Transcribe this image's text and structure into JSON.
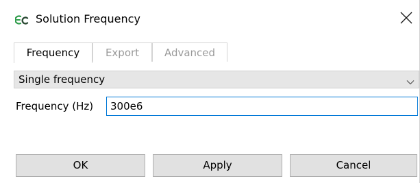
{
  "window": {
    "title": "Solution Frequency",
    "app_icon": "app-logo-icon",
    "close_icon": "close-icon"
  },
  "tabs": [
    {
      "label": "Frequency",
      "active": true
    },
    {
      "label": "Export",
      "active": false
    },
    {
      "label": "Advanced",
      "active": false
    }
  ],
  "frequency_tab": {
    "mode_select": {
      "selected": "Single frequency",
      "icon": "chevron-down-icon"
    },
    "frequency_field": {
      "label": "Frequency (Hz)",
      "value": "300e6"
    }
  },
  "buttons": {
    "ok": "OK",
    "apply": "Apply",
    "cancel": "Cancel"
  },
  "colors": {
    "input_focus_border": "#0078d7",
    "icon_green": "#2e9c4a",
    "icon_dark": "#2b4a34",
    "combo_background": "#e6e6e6",
    "button_background": "#e1e1e1"
  }
}
